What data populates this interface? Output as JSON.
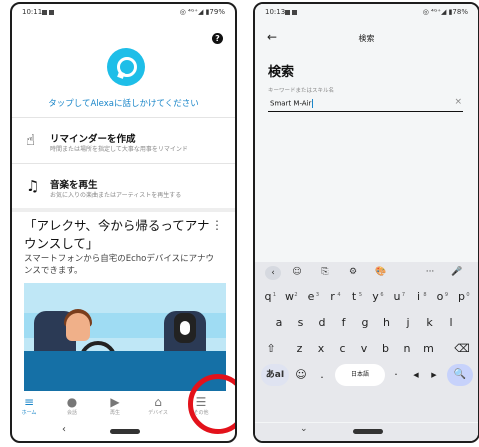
{
  "left": {
    "status": {
      "time": "10:11",
      "right": "◎ ⁴ᴳ⁺◢ ▮79%"
    },
    "help": "?",
    "tap_text": "タップしてAlexaに話しかけてください",
    "reminder": {
      "title": "リマインダーを作成",
      "sub": "時間または場所を指定して大事な用事をリマインド"
    },
    "music": {
      "title": "音楽を再生",
      "sub": "お気に入りの楽曲またはアーティストを再生する"
    },
    "promo": {
      "title": "「アレクサ、今から帰るってアナウンスして」",
      "desc": "スマートフォンから自宅のEchoデバイスにアナウンスできます。",
      "more": "⋮"
    },
    "nav": [
      {
        "glyph": "≡",
        "label": "ホーム"
      },
      {
        "glyph": "●",
        "label": "会話"
      },
      {
        "glyph": "▶",
        "label": "再生"
      },
      {
        "glyph": "⌂",
        "label": "デバイス"
      },
      {
        "glyph": "☰",
        "label": "その他"
      }
    ],
    "back": "‹"
  },
  "right": {
    "status": {
      "time": "10:13",
      "right": "◎ ⁴ᴳ⁺◢ ▮78%"
    },
    "header_title": "検索",
    "back_arrow": "←",
    "heading": "検索",
    "field_label": "キーワードまたはスキル名",
    "field_value": "Smart  M-Air",
    "clear": "×",
    "kb_top": [
      "‹",
      "☺",
      "⎘",
      "⚙",
      "🎨",
      "···",
      "🎤"
    ],
    "row1": [
      [
        "q",
        "1"
      ],
      [
        "w",
        "2"
      ],
      [
        "e",
        "3"
      ],
      [
        "r",
        "4"
      ],
      [
        "t",
        "5"
      ],
      [
        "y",
        "6"
      ],
      [
        "u",
        "7"
      ],
      [
        "i",
        "8"
      ],
      [
        "o",
        "9"
      ],
      [
        "p",
        "0"
      ]
    ],
    "row2": [
      "a",
      "s",
      "d",
      "f",
      "g",
      "h",
      "j",
      "k",
      "l"
    ],
    "row3": [
      "⇧",
      "z",
      "x",
      "c",
      "v",
      "b",
      "n",
      "m",
      "⌫"
    ],
    "row4": {
      "lang": "あaI",
      "emoji": "☺",
      "dot": ".",
      "space": "日本語",
      "comma": "·",
      "left": "◀",
      "right": "▶",
      "search": "🔍"
    },
    "down": "⌄"
  }
}
